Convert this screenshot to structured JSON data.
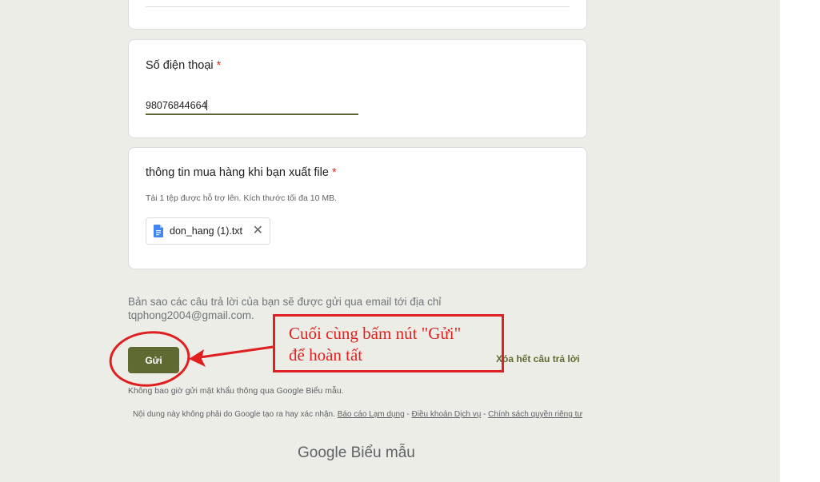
{
  "form": {
    "phone": {
      "title": "Số điện thoại",
      "required_mark": "*",
      "value": "98076844664"
    },
    "file_question": {
      "title": "thông tin mua hàng khi bạn xuất file",
      "required_mark": "*",
      "hint": "Tải 1 tệp được hỗ trợ lên. Kích thước tối đa 10 MB.",
      "file_name": "don_hang (1).txt",
      "file_icon": "doc-icon",
      "remove_icon": "close-icon"
    },
    "email_note": "Bản sao các câu trả lời của bạn sẽ được gửi qua email tới địa chỉ tqphong2004@gmail.com.",
    "submit_label": "Gửi",
    "clear_label": "Xóa hết câu trả lời",
    "password_note": "Không bao giờ gửi mật khẩu thông qua Google Biểu mẫu."
  },
  "footer": {
    "disclaimer": "Nội dung này không phải do Google tạo ra hay xác nhận.",
    "report_link": "Báo cáo Lạm dụng",
    "sep1": "-",
    "terms_link": "Điều khoản Dịch vụ",
    "sep2": "-",
    "privacy_link": "Chính sách quyền riêng tư",
    "logo_google": "Google",
    "logo_forms": "Biểu mẫu"
  },
  "annotation": {
    "line1": "Cuối cùng bấm nút \"Gửi\"",
    "line2": "để hoàn tất",
    "color": "#e02020"
  }
}
